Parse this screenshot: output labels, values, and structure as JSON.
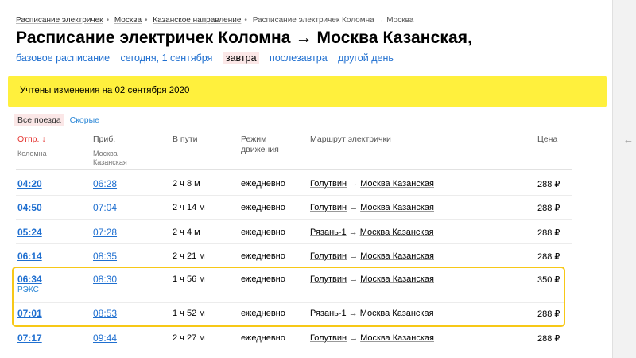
{
  "breadcrumbs": [
    "Расписание электричек",
    "Москва",
    "Казанское направление",
    "Расписание электричек Коломна → Москва"
  ],
  "title": "Расписание электричек Коломна → Москва Казанская,",
  "day_nav": [
    {
      "label": "базовое расписание",
      "active": false
    },
    {
      "label": "сегодня, 1 сентября",
      "active": false
    },
    {
      "label": "завтра",
      "active": true
    },
    {
      "label": "послезавтра",
      "active": false
    },
    {
      "label": "другой день",
      "active": false
    }
  ],
  "banner": "Учтены изменения на 02 сентября 2020",
  "filters": {
    "all": "Все поезда",
    "fast": "Скорые"
  },
  "columns": {
    "dep": "Отпр. ↓",
    "dep_sub": "Коломна",
    "arr": "Приб.",
    "arr_sub_1": "Москва",
    "arr_sub_2": "Казанская",
    "dur": "В пути",
    "mode_1": "Режим",
    "mode_2": "движения",
    "route": "Маршрут электрички",
    "price": "Цена"
  },
  "rows": [
    {
      "dep": "04:20",
      "arr": "06:28",
      "dur": "2 ч 8 м",
      "mode": "ежедневно",
      "from": "Голутвин",
      "to": "Москва Казанская",
      "price": "288 ₽",
      "tag": ""
    },
    {
      "dep": "04:50",
      "arr": "07:04",
      "dur": "2 ч 14 м",
      "mode": "ежедневно",
      "from": "Голутвин",
      "to": "Москва Казанская",
      "price": "288 ₽",
      "tag": ""
    },
    {
      "dep": "05:24",
      "arr": "07:28",
      "dur": "2 ч 4 м",
      "mode": "ежедневно",
      "from": "Рязань-1",
      "to": "Москва Казанская",
      "price": "288 ₽",
      "tag": ""
    },
    {
      "dep": "06:14",
      "arr": "08:35",
      "dur": "2 ч 21 м",
      "mode": "ежедневно",
      "from": "Голутвин",
      "to": "Москва Казанская",
      "price": "288 ₽",
      "tag": ""
    },
    {
      "dep": "06:34",
      "arr": "08:30",
      "dur": "1 ч 56 м",
      "mode": "ежедневно",
      "from": "Голутвин",
      "to": "Москва Казанская",
      "price": "350 ₽",
      "tag": "РЭКС"
    },
    {
      "dep": "07:01",
      "arr": "08:53",
      "dur": "1 ч 52 м",
      "mode": "ежедневно",
      "from": "Рязань-1",
      "to": "Москва Казанская",
      "price": "288 ₽",
      "tag": ""
    },
    {
      "dep": "07:17",
      "arr": "09:44",
      "dur": "2 ч 27 м",
      "mode": "ежедневно",
      "from": "Голутвин",
      "to": "Москва Казанская",
      "price": "288 ₽",
      "tag": ""
    }
  ],
  "colors": {
    "accent": "#fff03d",
    "link": "#1f6fd0",
    "highlight": "#f7c817",
    "sort": "#e53935"
  }
}
